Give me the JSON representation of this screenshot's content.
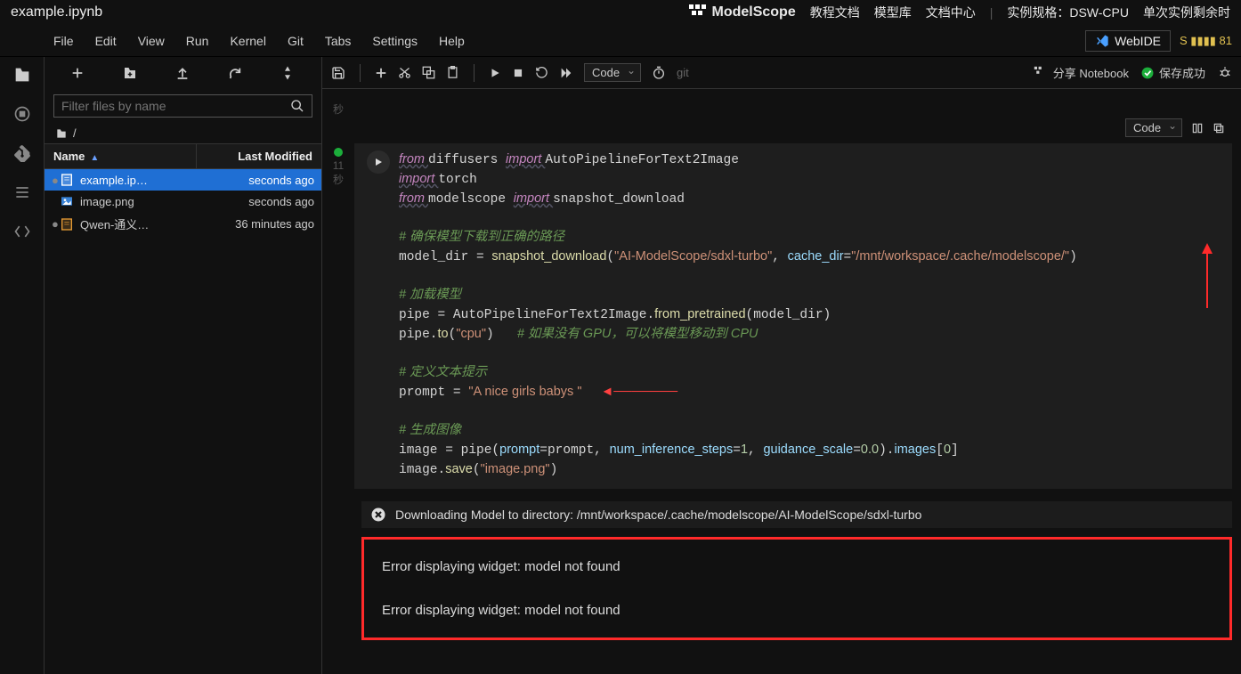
{
  "title": "example.ipynb",
  "brand": "ModelScope",
  "top_links": [
    "教程文档",
    "模型库",
    "文档中心"
  ],
  "spec_label": "实例规格：",
  "spec_value": "DSW-CPU",
  "remaining_label": "单次实例剩余时",
  "webide": "WebIDE",
  "licence_badge": "S ▮▮▮▮ 81",
  "menu": [
    "File",
    "Edit",
    "View",
    "Run",
    "Kernel",
    "Git",
    "Tabs",
    "Settings",
    "Help"
  ],
  "filter_placeholder": "Filter files by name",
  "breadcrumb": "/",
  "files_header": {
    "name": "Name",
    "modified": "Last Modified"
  },
  "files": [
    {
      "icon": "notebook",
      "name": "example.ip…",
      "modified": "seconds ago",
      "selected": true,
      "dirty": true
    },
    {
      "icon": "image",
      "name": "image.png",
      "modified": "seconds ago",
      "selected": false,
      "dirty": false
    },
    {
      "icon": "notebook",
      "name": "Qwen-通义…",
      "modified": "36 minutes ago",
      "selected": false,
      "dirty": true
    }
  ],
  "nb_toolbar_dropdown": "Code",
  "git_label": "git",
  "share_label": "分享 Notebook",
  "save_status": "保存成功",
  "cell_dropdown": "Code",
  "gutter_prev": "秒",
  "gutter_time": "11",
  "gutter_unit": "秒",
  "code_lines": [
    {
      "segs": [
        {
          "t": "from ",
          "c": "kw"
        },
        {
          "t": "diffusers ",
          "c": ""
        },
        {
          "t": "import ",
          "c": "kw"
        },
        {
          "t": "AutoPipelineForText2Image",
          "c": ""
        }
      ]
    },
    {
      "segs": [
        {
          "t": "import ",
          "c": "kw"
        },
        {
          "t": "torch",
          "c": ""
        }
      ]
    },
    {
      "segs": [
        {
          "t": "from ",
          "c": "kw"
        },
        {
          "t": "modelscope ",
          "c": ""
        },
        {
          "t": "import ",
          "c": "kw"
        },
        {
          "t": "snapshot_download",
          "c": ""
        }
      ]
    },
    {
      "segs": []
    },
    {
      "segs": [
        {
          "t": "# 确保模型下载到正确的路径",
          "c": "com"
        }
      ]
    },
    {
      "segs": [
        {
          "t": "model_dir ",
          "c": ""
        },
        {
          "t": "= ",
          "c": ""
        },
        {
          "t": "snapshot_download",
          "c": "fn"
        },
        {
          "t": "(",
          "c": ""
        },
        {
          "t": "\"AI-ModelScope/sdxl-turbo\"",
          "c": "str"
        },
        {
          "t": ", ",
          "c": ""
        },
        {
          "t": "cache_dir",
          "c": "attr"
        },
        {
          "t": "=",
          "c": ""
        },
        {
          "t": "\"/mnt/workspace/.cache/modelscope/\"",
          "c": "str"
        },
        {
          "t": ")",
          "c": ""
        }
      ]
    },
    {
      "segs": []
    },
    {
      "segs": [
        {
          "t": "# 加载模型",
          "c": "com"
        }
      ]
    },
    {
      "segs": [
        {
          "t": "pipe ",
          "c": ""
        },
        {
          "t": "= ",
          "c": ""
        },
        {
          "t": "AutoPipelineForText2Image",
          "c": ""
        },
        {
          "t": ".",
          "c": ""
        },
        {
          "t": "from_pretrained",
          "c": "fn"
        },
        {
          "t": "(model_dir)",
          "c": ""
        }
      ]
    },
    {
      "segs": [
        {
          "t": "pipe",
          "c": ""
        },
        {
          "t": ".",
          "c": ""
        },
        {
          "t": "to",
          "c": "fn"
        },
        {
          "t": "(",
          "c": ""
        },
        {
          "t": "\"cpu\"",
          "c": "str"
        },
        {
          "t": ")   ",
          "c": ""
        },
        {
          "t": "# 如果没有 GPU，可以将模型移动到 CPU",
          "c": "com"
        }
      ]
    },
    {
      "segs": []
    },
    {
      "segs": [
        {
          "t": "# 定义文本提示",
          "c": "com"
        }
      ]
    },
    {
      "segs": [
        {
          "t": "prompt ",
          "c": ""
        },
        {
          "t": "= ",
          "c": ""
        },
        {
          "t": "\"A nice girls babys \"",
          "c": "str"
        },
        {
          "t": "  ",
          "c": ""
        }
      ],
      "arrow": true
    },
    {
      "segs": []
    },
    {
      "segs": [
        {
          "t": "# 生成图像",
          "c": "com"
        }
      ]
    },
    {
      "segs": [
        {
          "t": "image ",
          "c": ""
        },
        {
          "t": "= ",
          "c": ""
        },
        {
          "t": "pipe",
          "c": ""
        },
        {
          "t": "(",
          "c": ""
        },
        {
          "t": "prompt",
          "c": "attr"
        },
        {
          "t": "=prompt, ",
          "c": ""
        },
        {
          "t": "num_inference_steps",
          "c": "attr"
        },
        {
          "t": "=",
          "c": ""
        },
        {
          "t": "1",
          "c": "num"
        },
        {
          "t": ", ",
          "c": ""
        },
        {
          "t": "guidance_scale",
          "c": "attr"
        },
        {
          "t": "=",
          "c": ""
        },
        {
          "t": "0.0",
          "c": "num"
        },
        {
          "t": ")",
          "c": ""
        },
        {
          "t": ".",
          "c": ""
        },
        {
          "t": "images",
          "c": "attr"
        },
        {
          "t": "[",
          "c": ""
        },
        {
          "t": "0",
          "c": "num"
        },
        {
          "t": "]",
          "c": ""
        }
      ]
    },
    {
      "segs": [
        {
          "t": "image",
          "c": ""
        },
        {
          "t": ".",
          "c": ""
        },
        {
          "t": "save",
          "c": "fn"
        },
        {
          "t": "(",
          "c": ""
        },
        {
          "t": "\"image.png\"",
          "c": "str"
        },
        {
          "t": ")",
          "c": ""
        }
      ]
    }
  ],
  "output_header": "Downloading Model to directory: /mnt/workspace/.cache/modelscope/AI-ModelScope/sdxl-turbo",
  "errors": [
    "Error displaying widget: model not found",
    "Error displaying widget: model not found"
  ]
}
